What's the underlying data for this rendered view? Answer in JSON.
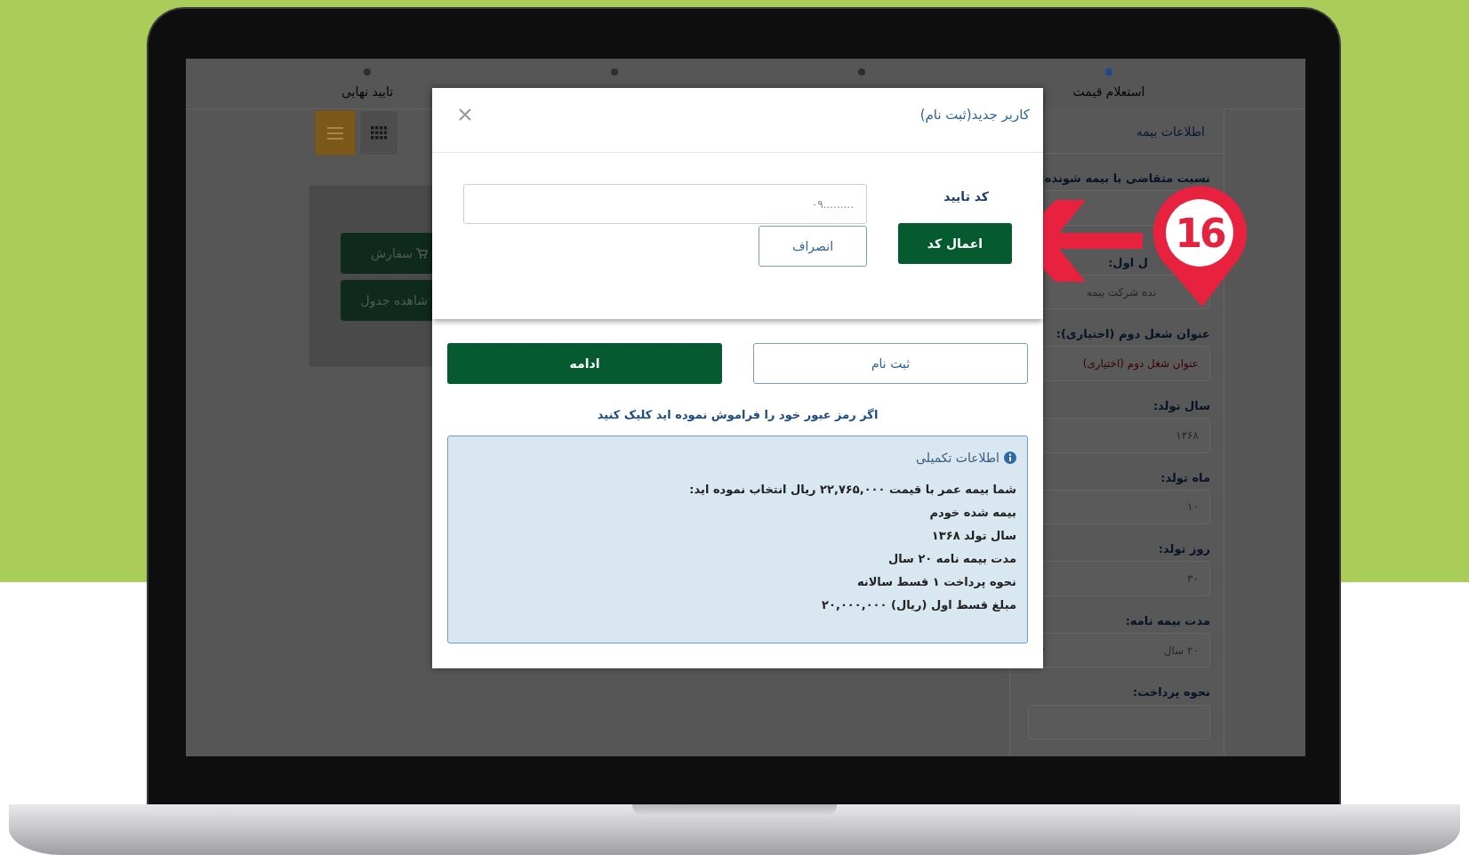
{
  "steps": [
    {
      "label": "استعلام قیمت",
      "selected": true
    },
    {
      "selected": false
    },
    {
      "selected": false
    },
    {
      "label": "تایید نهایی",
      "selected": false
    }
  ],
  "view_buttons": [
    {
      "kind": "list",
      "selected": true
    },
    {
      "kind": "grid",
      "selected": false
    }
  ],
  "left_card": {
    "buttons": [
      {
        "label": "سفارش",
        "kind": "cart"
      },
      {
        "label": "شاهده جدول",
        "kind": "plain"
      }
    ]
  },
  "side_panel": {
    "title": "اطلاعات بیمه",
    "fields": [
      {
        "label": "نسبت متقاضی با بیمه شونده:",
        "kind": "input"
      },
      {
        "label": "ل اول:",
        "kind": "input",
        "value": "نده شرکت بیمه"
      },
      {
        "label": "عنوان شغل دوم (اختیاری):",
        "kind": "input",
        "placeholder": "عنوان شغل دوم (اختیاری)"
      },
      {
        "label": "سال تولد:",
        "kind": "input",
        "value": "۱۳۶۸"
      },
      {
        "label": "ماه تولد:",
        "kind": "input",
        "value": "۱۰"
      },
      {
        "label": "روز تولد:",
        "kind": "input",
        "value": "۳۰"
      },
      {
        "label": "مدت بیمه نامه:",
        "kind": "select",
        "value": "۲۰ سال"
      },
      {
        "label": "نحوه پرداخت:",
        "kind": "input"
      }
    ]
  },
  "modal": {
    "title": "کاربر جدید(ثبت نام)",
    "code_label": "کد تایید",
    "code_field": {
      "placeholder": "۰۹........."
    },
    "apply_button": "اعمال کد",
    "cancel_button": "انصراف",
    "continue_button": "ادامه",
    "register_button": "ثبت نام",
    "forgot_link": "اگر رمز عبور خود را فراموش نموده اید کلیک کنید",
    "info": {
      "title": "اطلاعات تکمیلی",
      "lines": [
        "شما بیمه عمر با قیمت ۲۲,۷۶۵,۰۰۰ ریال انتخاب نموده اید:",
        "بیمه شده خودم",
        "سال تولد ۱۳۶۸",
        "مدت بیمه نامه ۲۰ سال",
        "نحوه پرداخت ۱ قسط سالانه",
        "مبلغ قسط اول (ریال) ۲۰,۰۰۰,۰۰۰"
      ]
    }
  },
  "callout": {
    "number": "16"
  }
}
